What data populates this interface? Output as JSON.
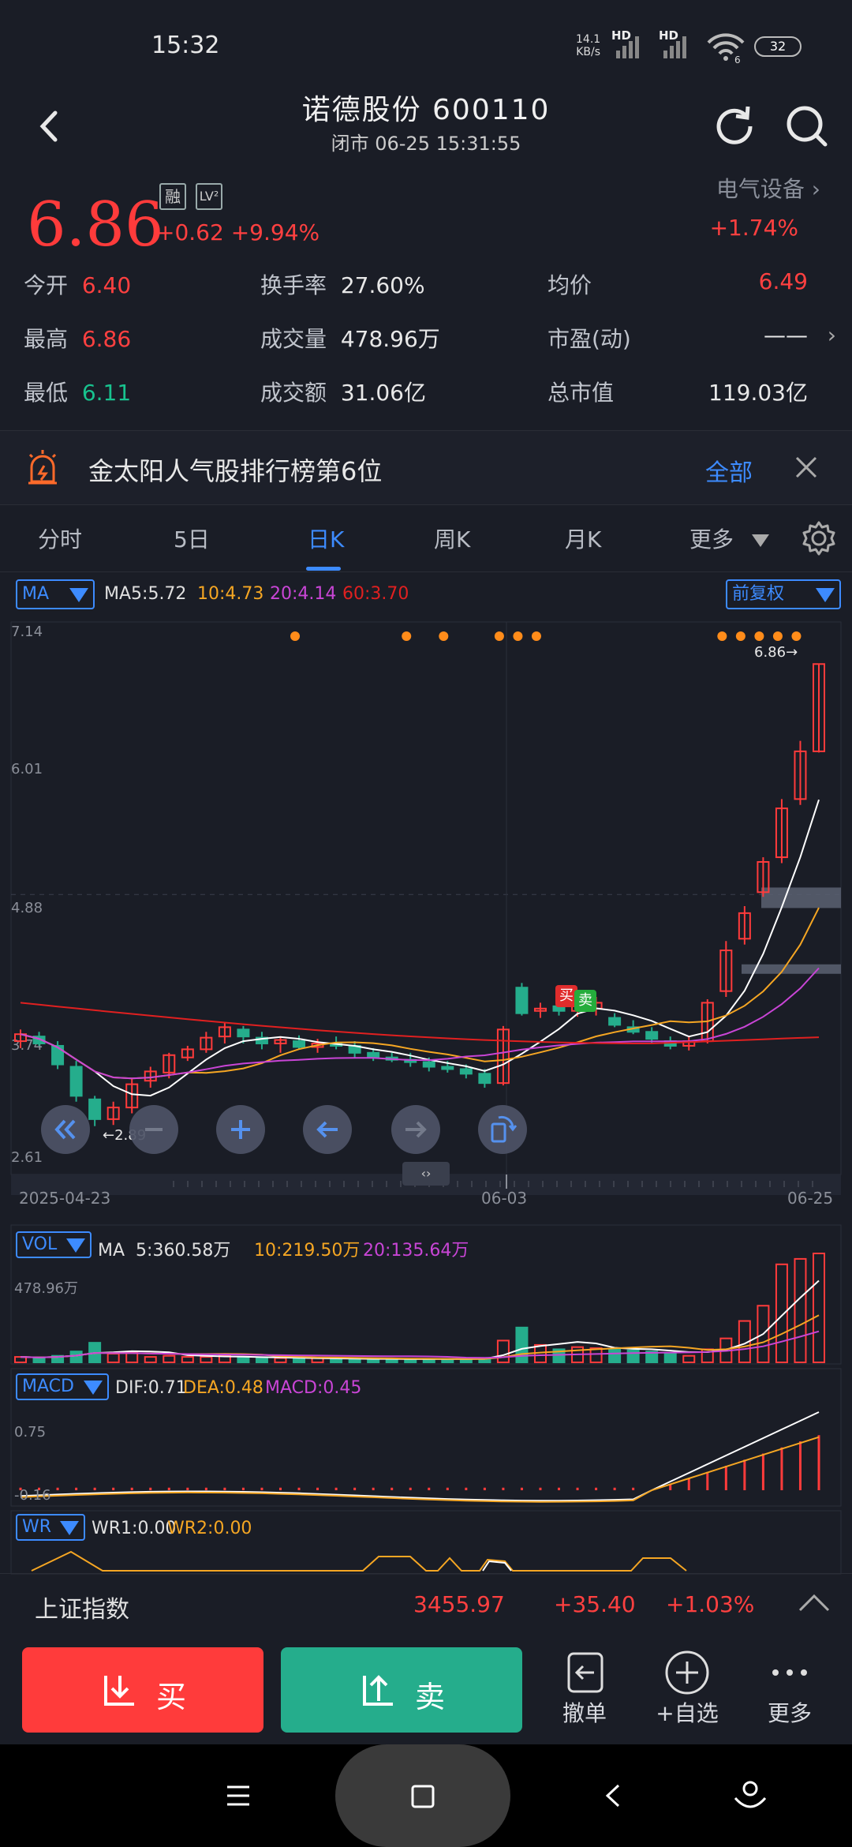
{
  "status_bar": {
    "time": "15:32",
    "net_speed": "14.1",
    "net_unit": "KB/s",
    "sim1": "HD",
    "sim2": "HD",
    "wifi_label": "6",
    "battery": "32"
  },
  "header": {
    "title": "诺德股份  600110",
    "subtitle": "闭市  06-25  15:31:55"
  },
  "quote": {
    "price": "6.86",
    "tag_margin": "融",
    "tag_level": "LV²",
    "change": "+0.62  +9.94%",
    "sector": "电气设备",
    "sector_change": "+1.74%",
    "rows": [
      {
        "label": "今开",
        "value": "6.40",
        "label2": "换手率",
        "value2": "27.60%",
        "label3": "均价",
        "value3": "6.49"
      },
      {
        "label": "最高",
        "value": "6.86",
        "label2": "成交量",
        "value2": "478.96万",
        "label3": "市盈(动)",
        "value3": "——"
      },
      {
        "label": "最低",
        "value": "6.11",
        "label2": "成交额",
        "value2": "31.06亿",
        "label3": "总市值",
        "value3": "119.03亿"
      }
    ]
  },
  "banner": {
    "text": "金太阳人气股排行榜第6位",
    "all": "全部"
  },
  "tabs": [
    "分时",
    "5日",
    "日K",
    "周K",
    "月K",
    "更多"
  ],
  "colors": {
    "up": "#ff3b3b",
    "down": "#25ad8c",
    "ma5": "#ffffff",
    "ma10": "#f5a623",
    "ma20": "#c945d6",
    "ma60": "#e02020",
    "accent": "#3d8bff"
  },
  "kline": {
    "indicator_dropdown": "MA",
    "adjust_dropdown": "前复权",
    "ma5": "MA5:5.72",
    "ma10": "10:4.73",
    "ma20": "20:4.14",
    "ma60": "60:3.70",
    "y_labels": [
      "7.14",
      "6.01",
      "4.88",
      "3.74",
      "2.61"
    ],
    "last_price_label": "6.86",
    "low_label": "2.89",
    "x_labels": [
      "2025-04-23",
      "06-03",
      "06-25"
    ],
    "buy_mark": "买",
    "sell_mark": "卖"
  },
  "chart_data": {
    "type": "candlestick",
    "ylim": [
      2.61,
      7.14
    ],
    "ohlc": [
      [
        3.62,
        3.72,
        3.56,
        3.68
      ],
      [
        3.66,
        3.7,
        3.58,
        3.6
      ],
      [
        3.58,
        3.62,
        3.38,
        3.42
      ],
      [
        3.4,
        3.45,
        3.1,
        3.15
      ],
      [
        3.12,
        3.15,
        2.89,
        2.95
      ],
      [
        2.95,
        3.1,
        2.9,
        3.05
      ],
      [
        3.05,
        3.3,
        3.0,
        3.25
      ],
      [
        3.28,
        3.4,
        3.22,
        3.36
      ],
      [
        3.35,
        3.52,
        3.3,
        3.5
      ],
      [
        3.48,
        3.58,
        3.45,
        3.55
      ],
      [
        3.55,
        3.7,
        3.52,
        3.65
      ],
      [
        3.66,
        3.78,
        3.6,
        3.74
      ],
      [
        3.72,
        3.75,
        3.6,
        3.66
      ],
      [
        3.65,
        3.7,
        3.55,
        3.6
      ],
      [
        3.6,
        3.66,
        3.52,
        3.63
      ],
      [
        3.62,
        3.67,
        3.55,
        3.57
      ],
      [
        3.57,
        3.64,
        3.52,
        3.6
      ],
      [
        3.6,
        3.66,
        3.55,
        3.58
      ],
      [
        3.58,
        3.62,
        3.48,
        3.52
      ],
      [
        3.52,
        3.56,
        3.45,
        3.48
      ],
      [
        3.48,
        3.52,
        3.44,
        3.46
      ],
      [
        3.46,
        3.52,
        3.4,
        3.44
      ],
      [
        3.44,
        3.48,
        3.36,
        3.4
      ],
      [
        3.4,
        3.45,
        3.35,
        3.38
      ],
      [
        3.38,
        3.42,
        3.3,
        3.34
      ],
      [
        3.34,
        3.38,
        3.22,
        3.26
      ],
      [
        3.26,
        3.75,
        3.24,
        3.72
      ],
      [
        4.08,
        4.12,
        3.84,
        3.86
      ],
      [
        3.88,
        3.95,
        3.82,
        3.9
      ],
      [
        3.92,
        3.96,
        3.84,
        3.88
      ],
      [
        3.88,
        3.95,
        3.83,
        3.92
      ],
      [
        3.9,
        4.0,
        3.84,
        3.95
      ],
      [
        3.82,
        3.86,
        3.74,
        3.76
      ],
      [
        3.74,
        3.8,
        3.68,
        3.7
      ],
      [
        3.7,
        3.74,
        3.6,
        3.64
      ],
      [
        3.62,
        3.66,
        3.55,
        3.58
      ],
      [
        3.58,
        3.66,
        3.54,
        3.62
      ],
      [
        3.62,
        3.98,
        3.6,
        3.95
      ],
      [
        4.05,
        4.48,
        4.0,
        4.4
      ],
      [
        4.5,
        4.78,
        4.45,
        4.72
      ],
      [
        4.9,
        5.2,
        4.86,
        5.16
      ],
      [
        5.2,
        5.7,
        5.15,
        5.62
      ],
      [
        5.7,
        6.2,
        5.65,
        6.11
      ],
      [
        6.11,
        6.86,
        6.1,
        6.86
      ]
    ],
    "ma5": 5.72,
    "ma10": 4.73,
    "ma20": 4.14,
    "ma60": 3.7,
    "volume": {
      "max": "478.96万",
      "ma5": "5:360.58万",
      "ma10": "10:219.50万",
      "ma20": "20:135.64万"
    },
    "macd": {
      "dif": "DIF:0.71",
      "dea": "DEA:0.48",
      "macd": "MACD:0.45",
      "y_label": "0.75",
      "y_label_low": "-0.16"
    },
    "wr": {
      "wr1": "WR1:0.00",
      "wr2": "WR2:0.00"
    }
  },
  "volume_panel": {
    "dropdown": "VOL",
    "ma_label": "MA",
    "max_label": "478.96万"
  },
  "macd_panel": {
    "dropdown": "MACD"
  },
  "wr_panel": {
    "dropdown": "WR"
  },
  "index_bar": {
    "name": "上证指数",
    "value": "3455.97",
    "change": "+35.40",
    "pct": "+1.03%"
  },
  "bottom": {
    "buy": "买",
    "sell": "卖",
    "cancel": "撤单",
    "watch": "+自选",
    "more": "更多"
  }
}
